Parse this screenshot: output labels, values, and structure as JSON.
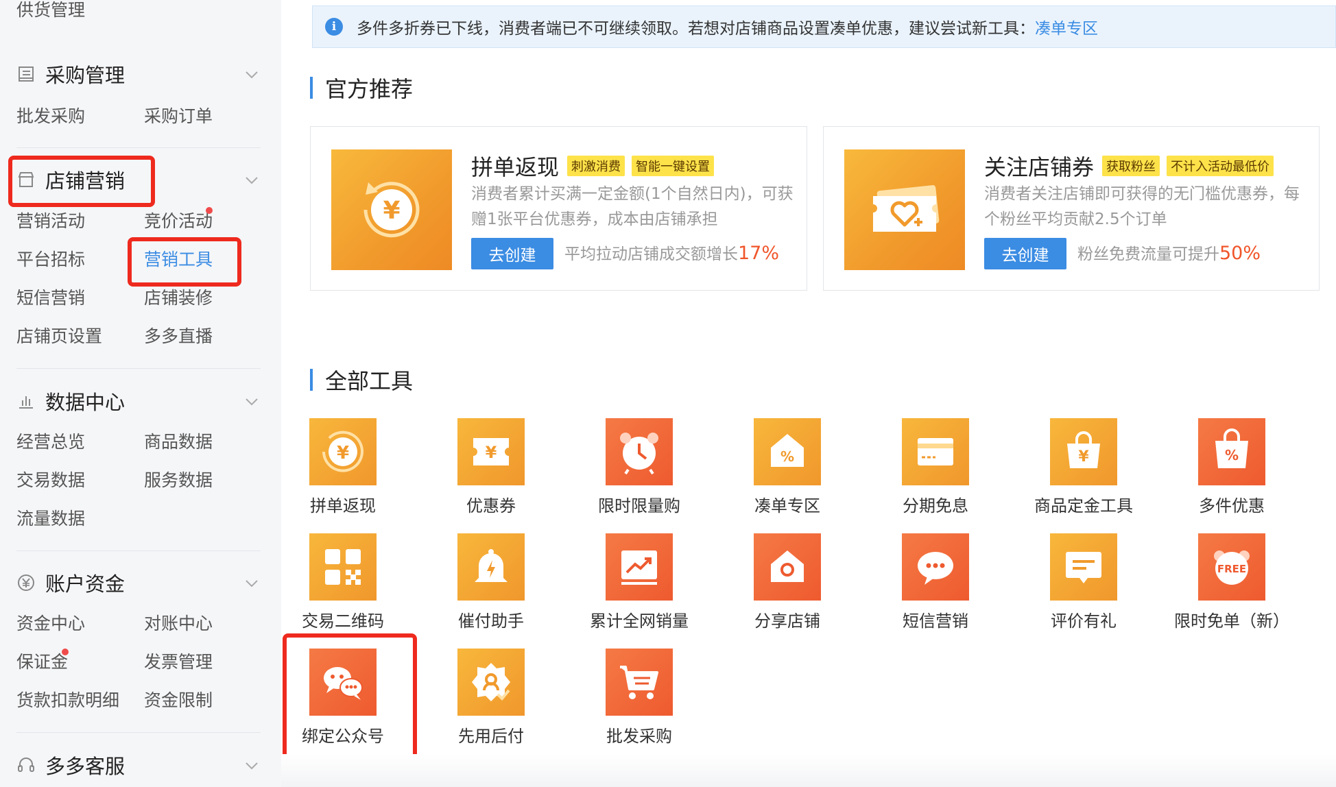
{
  "sidebar": {
    "top_item": "供货管理",
    "sections": [
      {
        "title": "采购管理",
        "icon": "list-icon",
        "items": [
          "批发采购",
          "采购订单"
        ]
      },
      {
        "title": "店铺营销",
        "icon": "store-icon",
        "items": [
          "营销活动",
          "竞价活动",
          "平台招标",
          "营销工具",
          "短信营销",
          "店铺装修",
          "店铺页设置",
          "多多直播"
        ]
      },
      {
        "title": "数据中心",
        "icon": "bar-chart-icon",
        "items": [
          "经营总览",
          "商品数据",
          "交易数据",
          "服务数据",
          "流量数据"
        ]
      },
      {
        "title": "账户资金",
        "icon": "yuan-icon",
        "items": [
          "资金中心",
          "对账中心",
          "保证金",
          "发票管理",
          "货款扣款明细",
          "资金限制"
        ]
      },
      {
        "title": "多多客服",
        "icon": "headset-icon",
        "items": []
      }
    ]
  },
  "notice": {
    "text": "多件多折券已下线，消费者端已不可继续领取。若想对店铺商品设置凑单优惠，建议尝试新工具：",
    "link": "凑单专区"
  },
  "recommend": {
    "title": "官方推荐",
    "cards": [
      {
        "title": "拼单返现",
        "tags": [
          "刺激消费",
          "智能一键设置"
        ],
        "desc": "消费者累计买满一定金额(1个自然日内)，可获赠1张平台优惠券，成本由店铺承担",
        "button": "去创建",
        "stat_text": "平均拉动店铺成交额增长",
        "stat_value": "17%"
      },
      {
        "title": "关注店铺券",
        "tags": [
          "获取粉丝",
          "不计入活动最低价"
        ],
        "desc": "消费者关注店铺即可获得的无门槛优惠券，每个粉丝平均贡献2.5个订单",
        "button": "去创建",
        "stat_text": "粉丝免费流量可提升",
        "stat_value": "50%"
      }
    ]
  },
  "tools": {
    "title": "全部工具",
    "items": [
      {
        "label": "拼单返现",
        "icon": "cashback-icon"
      },
      {
        "label": "优惠券",
        "icon": "coupon-icon"
      },
      {
        "label": "限时限量购",
        "icon": "alarm-clock-icon"
      },
      {
        "label": "凑单专区",
        "icon": "discount-bag-icon"
      },
      {
        "label": "分期免息",
        "icon": "credit-card-icon"
      },
      {
        "label": "商品定金工具",
        "icon": "deposit-bag-icon"
      },
      {
        "label": "多件优惠",
        "icon": "percent-bag-icon"
      },
      {
        "label": "交易二维码",
        "icon": "qr-code-icon"
      },
      {
        "label": "催付助手",
        "icon": "bell-icon"
      },
      {
        "label": "累计全网销量",
        "icon": "trend-chart-icon"
      },
      {
        "label": "分享店铺",
        "icon": "share-store-icon"
      },
      {
        "label": "短信营销",
        "icon": "sms-bubble-icon"
      },
      {
        "label": "评价有礼",
        "icon": "review-icon"
      },
      {
        "label": "限时免单（新）",
        "icon": "free-icon"
      },
      {
        "label": "绑定公众号",
        "icon": "wechat-icon"
      },
      {
        "label": "先用后付",
        "icon": "badge-check-icon"
      },
      {
        "label": "批发采购",
        "icon": "cart-icon"
      }
    ]
  },
  "free_badge_text": "FREE",
  "colors": {
    "accent": "#3b8ce3",
    "highlight_box": "#ee2a1e",
    "orange": "#f19a2c",
    "red_orange": "#ee5a2f"
  }
}
